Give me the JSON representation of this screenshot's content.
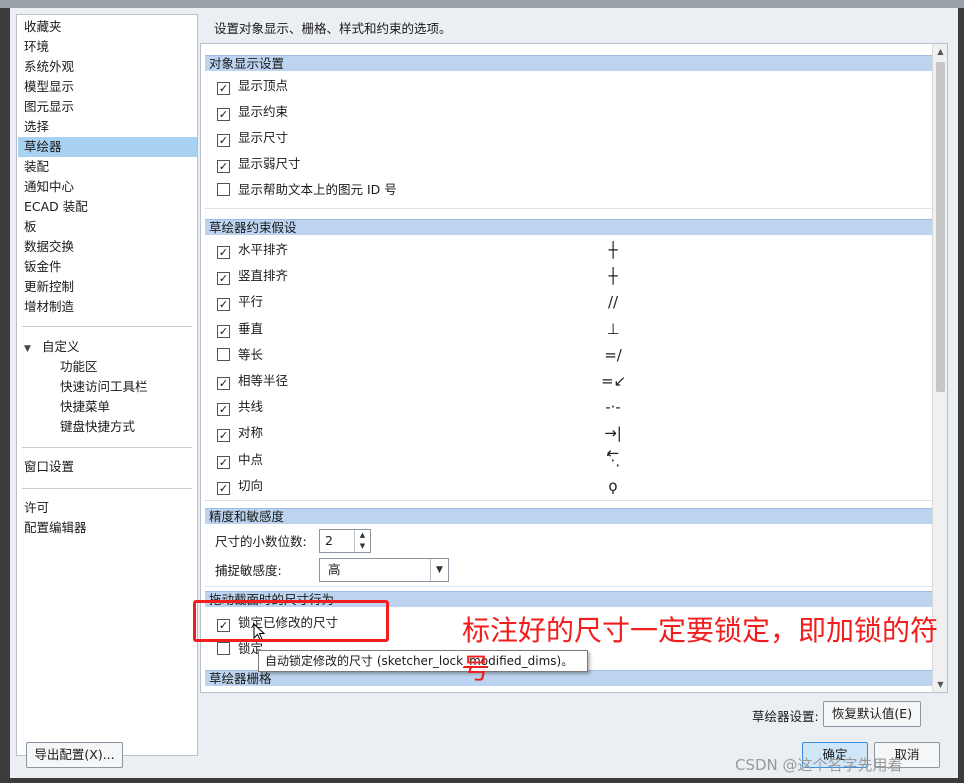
{
  "nav": {
    "items": [
      "收藏夹",
      "环境",
      "系统外观",
      "模型显示",
      "图元显示",
      "选择",
      "草绘器",
      "装配",
      "通知中心",
      "ECAD 装配",
      "板",
      "数据交换",
      "钣金件",
      "更新控制",
      "增材制造"
    ],
    "selected_index": 6,
    "custom_group": "自定义",
    "custom_items": [
      "功能区",
      "快速访问工具栏",
      "快捷菜单",
      "键盘快捷方式"
    ],
    "window_settings": "窗口设置",
    "extra_items": [
      "许可",
      "配置编辑器"
    ]
  },
  "description": "设置对象显示、栅格、样式和约束的选项。",
  "sections": {
    "display": {
      "title": "对象显示设置",
      "items": [
        {
          "label": "显示顶点",
          "checked": true
        },
        {
          "label": "显示约束",
          "checked": true
        },
        {
          "label": "显示尺寸",
          "checked": true
        },
        {
          "label": "显示弱尺寸",
          "checked": true
        },
        {
          "label": "显示帮助文本上的图元 ID 号",
          "checked": false
        }
      ]
    },
    "constraints": {
      "title": "草绘器约束假设",
      "items": [
        {
          "label": "水平排齐",
          "checked": true,
          "symbol": "┼",
          "icon": "horizontal-constraint-icon"
        },
        {
          "label": "竖直排齐",
          "checked": true,
          "symbol": "┼",
          "icon": "vertical-constraint-icon"
        },
        {
          "label": "平行",
          "checked": true,
          "symbol": "//",
          "icon": "parallel-constraint-icon"
        },
        {
          "label": "垂直",
          "checked": true,
          "symbol": "⊥",
          "icon": "perpendicular-constraint-icon"
        },
        {
          "label": "等长",
          "checked": false,
          "symbol": "=/",
          "icon": "equal-length-constraint-icon"
        },
        {
          "label": "相等半径",
          "checked": true,
          "symbol": "=↙",
          "icon": "equal-radius-constraint-icon"
        },
        {
          "label": "共线",
          "checked": true,
          "symbol": "-·-",
          "icon": "collinear-constraint-icon"
        },
        {
          "label": "对称",
          "checked": true,
          "symbol": "→|←",
          "icon": "symmetric-constraint-icon"
        },
        {
          "label": "中点",
          "checked": true,
          "symbol": "⋱",
          "icon": "midpoint-constraint-icon"
        },
        {
          "label": "切向",
          "checked": true,
          "symbol": "ϙ",
          "icon": "tangent-constraint-icon"
        }
      ]
    },
    "precision": {
      "title": "精度和敏感度",
      "decimals_label": "尺寸的小数位数:",
      "decimals_value": "2",
      "snap_label": "捕捉敏感度:",
      "snap_value": "高"
    },
    "drag": {
      "title": "拖动截面时的尺寸行为",
      "items": [
        {
          "label": "锁定已修改的尺寸",
          "checked": true
        },
        {
          "label": "锁定",
          "checked": false
        }
      ]
    },
    "grid": {
      "title": "草绘器栅格"
    }
  },
  "tooltip": "自动锁定修改的尺寸 (sketcher_lock_modified_dims)。",
  "annotation": "标注好的尺寸一定要锁定，即加锁的符号",
  "footer": {
    "sketcher_settings_label": "草绘器设置:",
    "restore_defaults": "恢复默认值(E)",
    "export_config": "导出配置(X)...",
    "ok": "确定",
    "cancel": "取消"
  },
  "watermark": "CSDN @这个名字先用着",
  "colors": {
    "accent": "#a9d2f2",
    "section": "#bcd4ef",
    "annotation": "#f21d1d"
  }
}
